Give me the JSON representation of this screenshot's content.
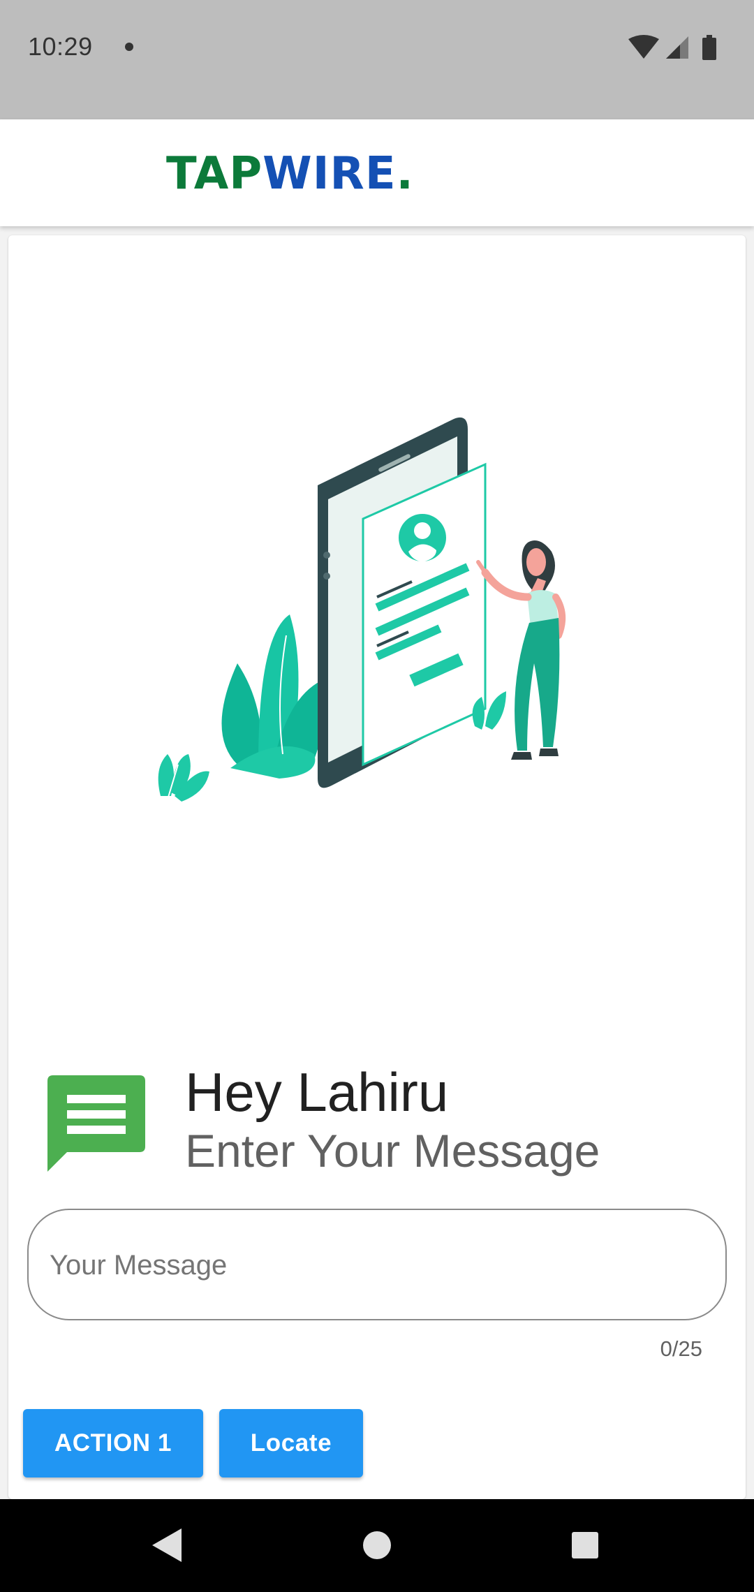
{
  "status_bar": {
    "time": "10:29",
    "icons": [
      "notification-dot-icon",
      "wifi-icon",
      "cell-signal-icon",
      "battery-icon"
    ]
  },
  "app_bar": {
    "logo_part1": "TAP",
    "logo_part2": "WIRE",
    "logo_part3": ".",
    "colors": {
      "green": "#0c7a3a",
      "blue": "#1450b4"
    }
  },
  "main": {
    "greeting": "Hey Lahiru",
    "subtitle": "Enter Your Message",
    "message_input": {
      "value": "",
      "placeholder": "Your Message"
    },
    "counter": "0/25",
    "buttons": {
      "action1_label": "ACTION 1",
      "locate_label": "Locate"
    },
    "accent_color": "#2196f3",
    "icon_color": "#4caf50"
  },
  "nav_bar": {
    "icons": [
      "back-icon",
      "home-icon",
      "recents-icon"
    ]
  }
}
